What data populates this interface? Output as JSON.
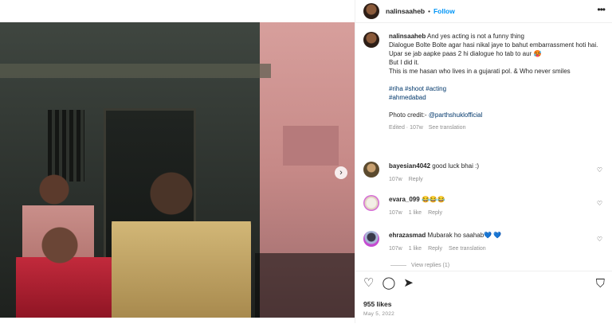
{
  "post": {
    "username": "nalinsaaheb",
    "follow_label": "Follow",
    "more_label": "•••",
    "caption_lines": [
      "And yes acting is not a funny thing",
      "Dialogue Bolte Bolte agar hasi nikal jaye to bahut embarrassment hoti hai.",
      "Upar se jab aapke paas 2 hi dialogue ho tab to aur 🥵",
      "But I did it.",
      "This is me hasan who lives in a gujarati pol. & Who never smiles"
    ],
    "hashtags_line1": "#riha #shoot #acting",
    "hashtags_line2": "#ahmedabad",
    "photo_credit_prefix": "Photo credit:- ",
    "photo_credit_handle": "@parthshuklofficial",
    "edited": "Edited · 107w",
    "see_translation": "See translation",
    "next_icon": "›"
  },
  "comments": [
    {
      "user": "bayesian4042",
      "text": "good luck bhai :)",
      "time": "107w",
      "likes": "",
      "reply": "Reply",
      "translation": ""
    },
    {
      "user": "evara_099",
      "text": "😂😂😂",
      "time": "107w",
      "likes": "1 like",
      "reply": "Reply",
      "translation": ""
    },
    {
      "user": "ehrazasmad",
      "text": "Mubarak ho saahab💙 💙",
      "time": "107w",
      "likes": "1 like",
      "reply": "Reply",
      "translation": "See translation"
    }
  ],
  "view_replies": "View replies (1)",
  "actions": {
    "like_icon": "♡",
    "comment_icon": "◯",
    "share_icon": "➤",
    "save_icon": "⛉"
  },
  "likes": "955 likes",
  "date": "May 5, 2022"
}
